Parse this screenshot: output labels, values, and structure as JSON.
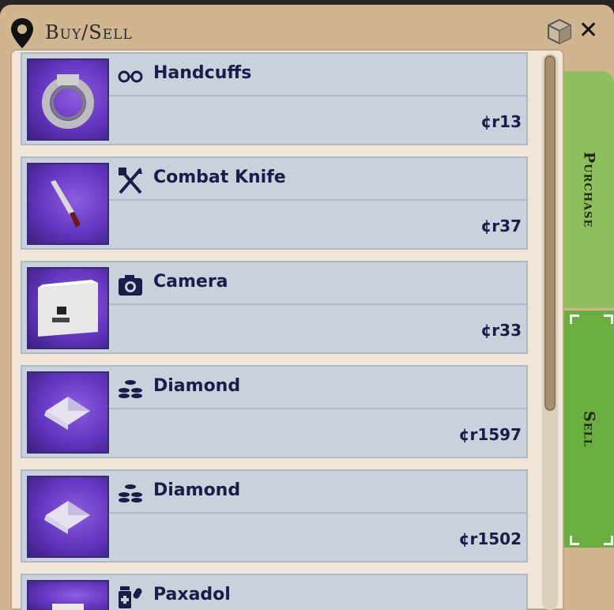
{
  "window": {
    "title": "Buy/Sell"
  },
  "tabs": [
    {
      "label": "Purchase"
    },
    {
      "label": "Sell"
    }
  ],
  "items": [
    {
      "name": "Handcuffs",
      "price": "¢r13",
      "icon": "handcuffs-icon"
    },
    {
      "name": "Combat Knife",
      "price": "¢r37",
      "icon": "fork-knife-icon"
    },
    {
      "name": "Camera",
      "price": "¢r33",
      "icon": "camera-icon"
    },
    {
      "name": "Diamond",
      "price": "¢r1597",
      "icon": "coins-icon"
    },
    {
      "name": "Diamond",
      "price": "¢r1502",
      "icon": "coins-icon"
    },
    {
      "name": "Paxadol",
      "price": "",
      "icon": "medicine-icon"
    }
  ],
  "colors": {
    "tab_purchase": "#8ebf5c",
    "tab_sell": "#6aad40",
    "text": "#1c1c48",
    "thumb_bg": "#6236bf"
  }
}
